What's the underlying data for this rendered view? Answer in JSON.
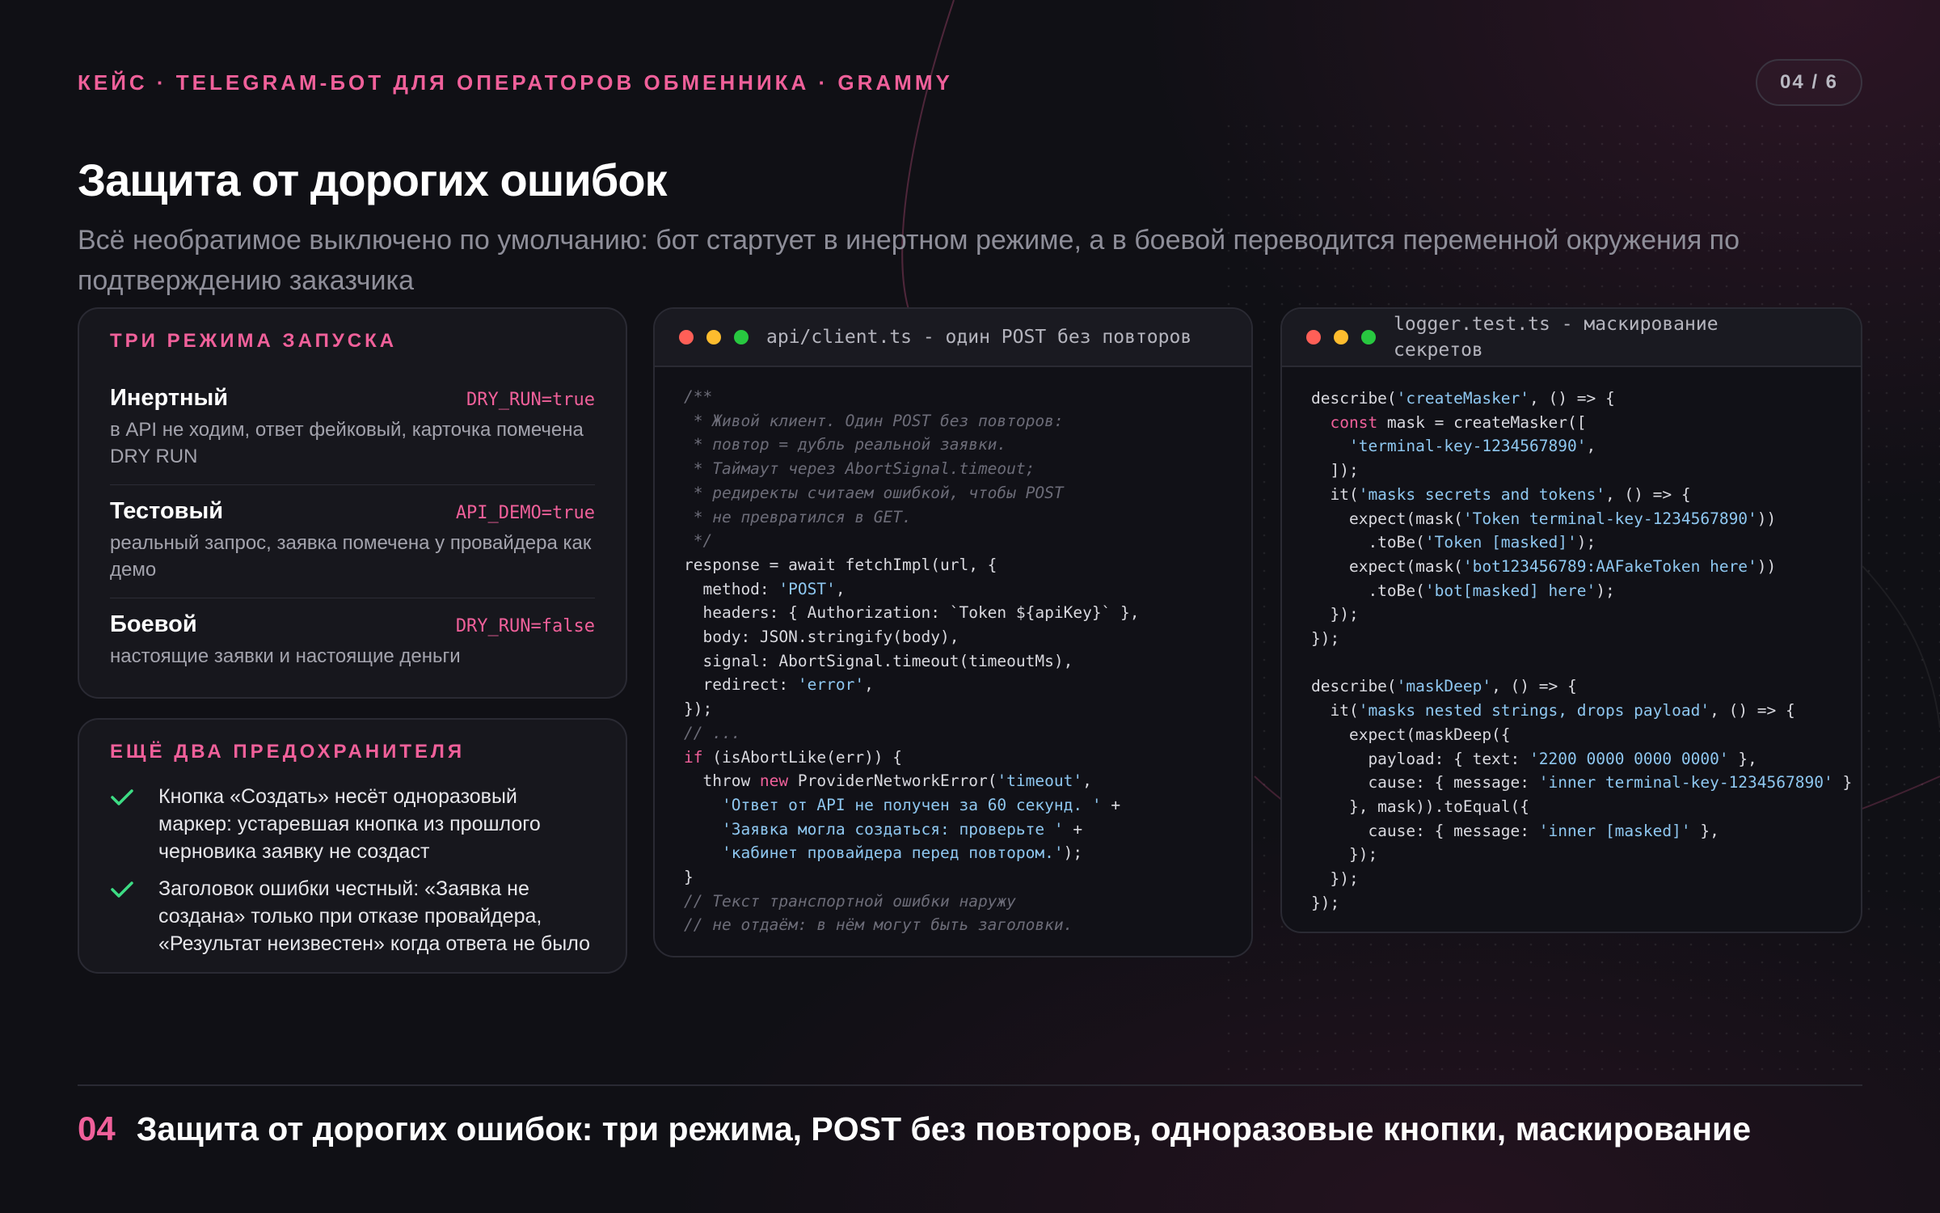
{
  "header": {
    "eyebrow": "КЕЙС · TELEGRAM-БОТ ДЛЯ ОПЕРАТОРОВ ОБМЕННИКА · GRAMMY",
    "page_indicator": "04 / 6"
  },
  "title": "Защита от дорогих ошибок",
  "subtitle": "Всё необратимое выключено по умолчанию: бот стартует в инертном режиме, а в боевой переводится переменной окружения по подтверждению заказчика",
  "modes_card": {
    "heading": "ТРИ РЕЖИМА ЗАПУСКА",
    "items": [
      {
        "name": "Инертный",
        "flag": "DRY_RUN=true",
        "desc": "в API не ходим, ответ фейковый, карточка помечена DRY RUN"
      },
      {
        "name": "Тестовый",
        "flag": "API_DEMO=true",
        "desc": "реальный запрос, заявка помечена у провайдера как демо"
      },
      {
        "name": "Боевой",
        "flag": "DRY_RUN=false",
        "desc": "настоящие заявки и настоящие деньги"
      }
    ]
  },
  "guards_card": {
    "heading": "ЕЩЁ ДВА ПРЕДОХРАНИТЕЛЯ",
    "items": [
      {
        "icon": "check-icon",
        "text": "Кнопка «Создать» несёт одноразовый маркер: устаревшая кнопка из прошлого черновика заявку не создаст"
      },
      {
        "icon": "check-icon",
        "text": "Заголовок ошибки честный: «Заявка не создана» только при отказе провайдера, «Результат неизвестен» когда ответа не было"
      }
    ]
  },
  "client_code": {
    "filename": "api/client.ts - один POST без повторов",
    "lines": [
      [
        [
          "c",
          "/**"
        ]
      ],
      [
        [
          "c",
          " * Живой клиент. Один POST без повторов:"
        ]
      ],
      [
        [
          "c",
          " * повтор = дубль реальной заявки."
        ]
      ],
      [
        [
          "c",
          " * Таймаут через AbortSignal.timeout;"
        ]
      ],
      [
        [
          "c",
          " * редиректы считаем ошибкой, чтобы POST"
        ]
      ],
      [
        [
          "c",
          " * не превратился в GET."
        ]
      ],
      [
        [
          "c",
          " */"
        ]
      ],
      [
        [
          "p",
          "response = await fetchImpl(url, {"
        ]
      ],
      [
        [
          "p",
          "  method: "
        ],
        [
          "s",
          "'POST'"
        ],
        [
          "p",
          ","
        ]
      ],
      [
        [
          "p",
          "  headers: { Authorization: `Token ${apiKey}` },"
        ]
      ],
      [
        [
          "p",
          "  body: JSON.stringify(body),"
        ]
      ],
      [
        [
          "p",
          "  signal: AbortSignal.timeout(timeoutMs),"
        ]
      ],
      [
        [
          "p",
          "  redirect: "
        ],
        [
          "s",
          "'error'"
        ],
        [
          "p",
          ","
        ]
      ],
      [
        [
          "p",
          "});"
        ]
      ],
      [
        [
          "c",
          "// ..."
        ]
      ],
      [
        [
          "k",
          "if"
        ],
        [
          "p",
          " (isAbortLike(err)) {"
        ]
      ],
      [
        [
          "p",
          "  throw "
        ],
        [
          "k",
          "new"
        ],
        [
          "p",
          " ProviderNetworkError("
        ],
        [
          "s",
          "'timeout'"
        ],
        [
          "p",
          ","
        ]
      ],
      [
        [
          "p",
          "    "
        ],
        [
          "s",
          "'Ответ от API не получен за 60 секунд. '"
        ],
        [
          "p",
          " +"
        ]
      ],
      [
        [
          "p",
          "    "
        ],
        [
          "s",
          "'Заявка могла создаться: проверьте '"
        ],
        [
          "p",
          " +"
        ]
      ],
      [
        [
          "p",
          "    "
        ],
        [
          "s",
          "'кабинет провайдера перед повтором.'"
        ],
        [
          "p",
          ");"
        ]
      ],
      [
        [
          "p",
          "}"
        ]
      ],
      [
        [
          "c",
          "// Текст транспортной ошибки наружу"
        ]
      ],
      [
        [
          "c",
          "// не отдаём: в нём могут быть заголовки."
        ]
      ]
    ]
  },
  "logger_code": {
    "filename": "logger.test.ts - маскирование секретов",
    "lines": [
      [
        [
          "p",
          "describe("
        ],
        [
          "s",
          "'createMasker'"
        ],
        [
          "p",
          ", () => {"
        ]
      ],
      [
        [
          "k",
          "  const"
        ],
        [
          "p",
          " mask = createMasker(["
        ]
      ],
      [
        [
          "p",
          "    "
        ],
        [
          "s",
          "'terminal-key-1234567890'"
        ],
        [
          "p",
          ","
        ]
      ],
      [
        [
          "p",
          "  ]);"
        ]
      ],
      [
        [
          "p",
          "  it("
        ],
        [
          "s",
          "'masks secrets and tokens'"
        ],
        [
          "p",
          ", () => {"
        ]
      ],
      [
        [
          "p",
          "    expect(mask("
        ],
        [
          "s",
          "'Token terminal-key-1234567890'"
        ],
        [
          "p",
          "))"
        ]
      ],
      [
        [
          "p",
          "      .toBe("
        ],
        [
          "s",
          "'Token [masked]'"
        ],
        [
          "p",
          ");"
        ]
      ],
      [
        [
          "p",
          "    expect(mask("
        ],
        [
          "s",
          "'bot123456789:AAFakeToken here'"
        ],
        [
          "p",
          "))"
        ]
      ],
      [
        [
          "p",
          "      .toBe("
        ],
        [
          "s",
          "'bot[masked] here'"
        ],
        [
          "p",
          ");"
        ]
      ],
      [
        [
          "p",
          "  });"
        ]
      ],
      [
        [
          "p",
          "});"
        ]
      ],
      [
        [
          "p",
          ""
        ]
      ],
      [
        [
          "p",
          "describe("
        ],
        [
          "s",
          "'maskDeep'"
        ],
        [
          "p",
          ", () => {"
        ]
      ],
      [
        [
          "p",
          "  it("
        ],
        [
          "s",
          "'masks nested strings, drops payload'"
        ],
        [
          "p",
          ", () => {"
        ]
      ],
      [
        [
          "p",
          "    expect(maskDeep({"
        ]
      ],
      [
        [
          "p",
          "      payload: { text: "
        ],
        [
          "s",
          "'2200 0000 0000 0000'"
        ],
        [
          "p",
          " },"
        ]
      ],
      [
        [
          "p",
          "      cause: { message: "
        ],
        [
          "s",
          "'inner terminal-key-1234567890'"
        ],
        [
          "p",
          " }"
        ]
      ],
      [
        [
          "p",
          "    }, mask)).toEqual({"
        ]
      ],
      [
        [
          "p",
          "      cause: { message: "
        ],
        [
          "s",
          "'inner [masked]'"
        ],
        [
          "p",
          " },"
        ]
      ],
      [
        [
          "p",
          "    });"
        ]
      ],
      [
        [
          "p",
          "  });"
        ]
      ],
      [
        [
          "p",
          "});"
        ]
      ]
    ]
  },
  "footer": {
    "number": "04",
    "text": "Защита от дорогих ошибок: три режима, POST без повторов, одноразовые кнопки, маскирование"
  },
  "colors": {
    "accent": "#f0609a",
    "background": "#101015",
    "card": "#17171d",
    "string": "#8ec7f0",
    "check": "#3ddc84"
  }
}
